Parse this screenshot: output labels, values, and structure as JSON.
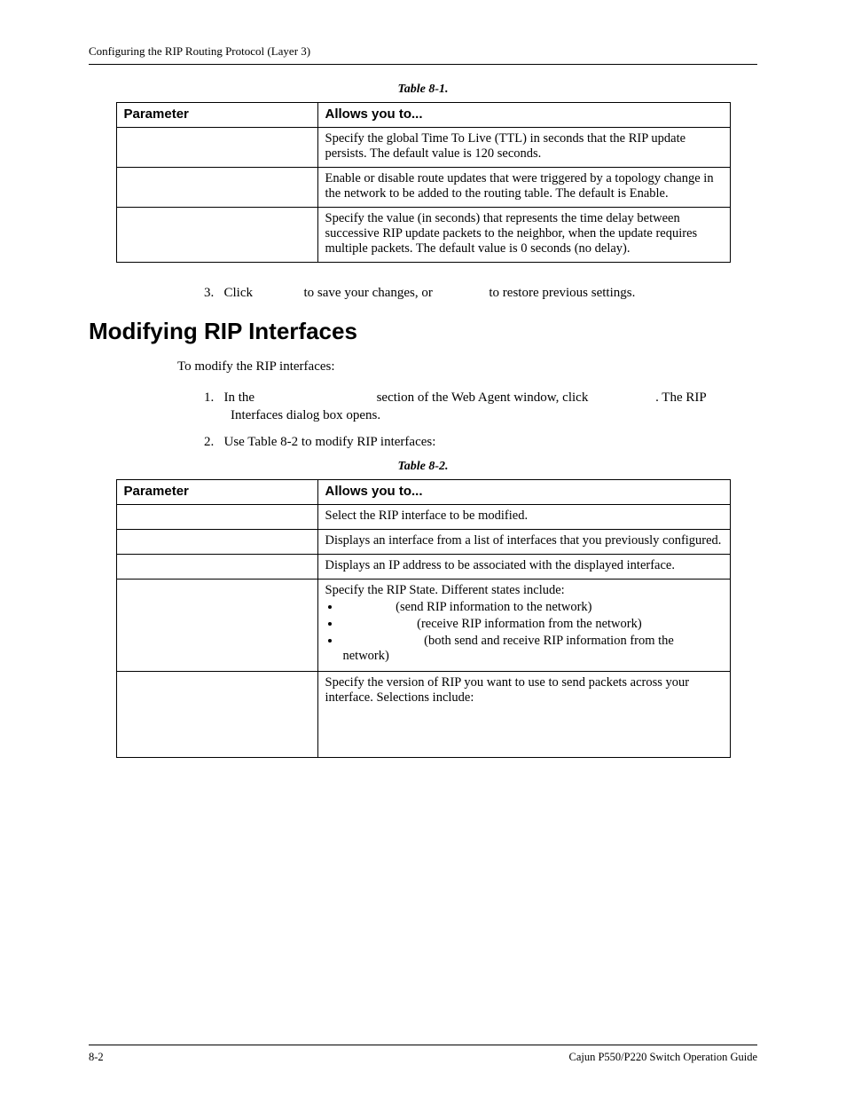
{
  "header": {
    "running_head": "Configuring the RIP Routing Protocol (Layer 3)"
  },
  "table1": {
    "caption": "Table 8-1.",
    "headers": {
      "param": "Parameter",
      "allows": "Allows you to..."
    },
    "rows": [
      {
        "param": "",
        "desc": "Specify the global Time To Live (TTL) in seconds that the RIP update persists. The default value is 120 seconds."
      },
      {
        "param": "",
        "desc": "Enable or disable route updates that were triggered by a topology change in the network to be added to the routing table. The default is Enable."
      },
      {
        "param": "",
        "desc": "Specify the value (in seconds) that represents the time delay between successive RIP update packets to the neighbor, when the update requires multiple packets. The default value is 0 seconds (no delay)."
      }
    ]
  },
  "step3": {
    "num": "3.",
    "click": "Click ",
    "mid": " to save your changes, or ",
    "end": " to restore previous settings."
  },
  "section_title": "Modifying RIP Interfaces",
  "intro": "To modify the RIP interfaces:",
  "steps": {
    "s1_num": "1.",
    "s1_a": "In the ",
    "s1_b": " section of the Web Agent window, click ",
    "s1_c": ". The RIP Interfaces dialog box opens.",
    "s2_num": "2.",
    "s2": "Use Table 8-2 to modify RIP interfaces:"
  },
  "table2": {
    "caption": "Table 8-2.",
    "headers": {
      "param": "Parameter",
      "allows": "Allows you to..."
    },
    "rows": {
      "r1": {
        "param": "",
        "desc": "Select the RIP interface to be modified."
      },
      "r2": {
        "param": "",
        "desc": "Displays an interface from a list of interfaces that you previously configured."
      },
      "r3": {
        "param": "",
        "desc": "Displays an IP address to be associated with the displayed interface."
      },
      "r4": {
        "param": "",
        "lead": "Specify the RIP State. Different states include:",
        "b1_tail": " (send RIP information to the network)",
        "b2_tail": " (receive RIP information from the network)",
        "b3_tail": " (both send and receive RIP information from the network)"
      },
      "r5": {
        "param": "",
        "desc": "Specify the version of RIP you want to use to send packets across your interface. Selections include:"
      }
    }
  },
  "footer": {
    "page": "8-2",
    "title": "Cajun P550/P220 Switch Operation Guide"
  }
}
